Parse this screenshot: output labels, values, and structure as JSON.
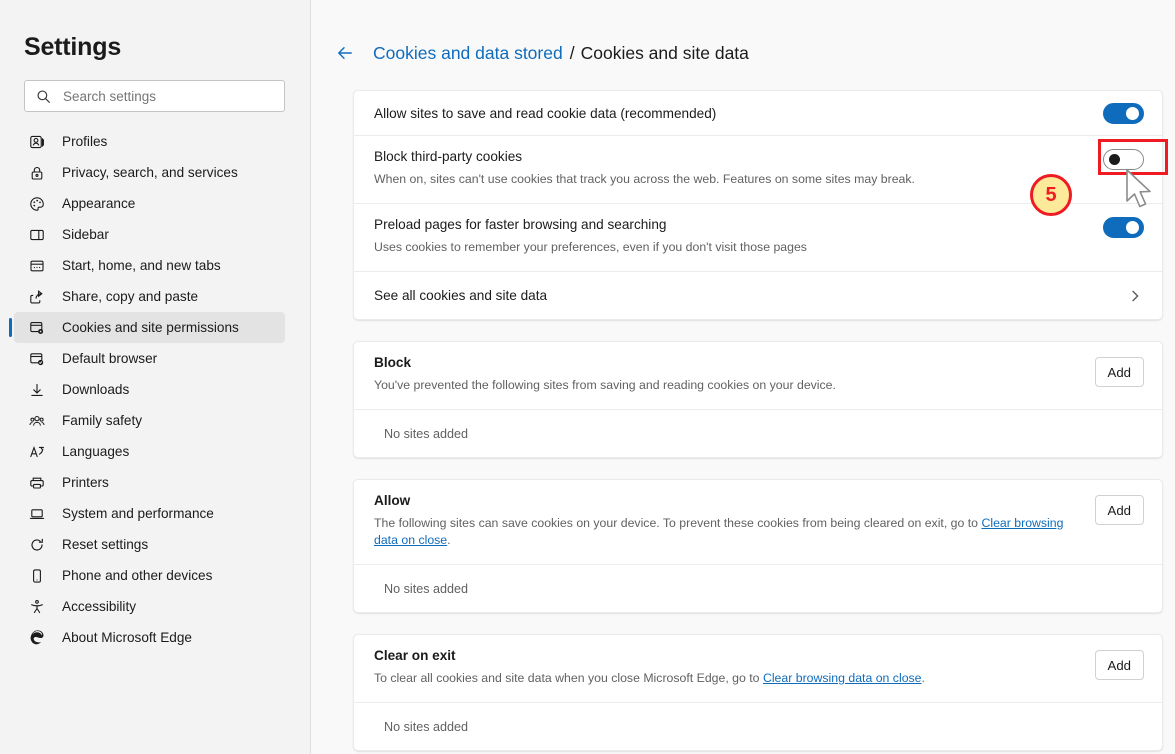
{
  "sidebar": {
    "title": "Settings",
    "search": {
      "placeholder": "Search settings",
      "value": "",
      "icon": "search-icon"
    },
    "items": [
      {
        "label": "Profiles",
        "icon": "profiles-icon",
        "selected": false
      },
      {
        "label": "Privacy, search, and services",
        "icon": "lock-icon",
        "selected": false
      },
      {
        "label": "Appearance",
        "icon": "palette-icon",
        "selected": false
      },
      {
        "label": "Sidebar",
        "icon": "sidebar-icon",
        "selected": false
      },
      {
        "label": "Start, home, and new tabs",
        "icon": "browser-window-icon",
        "selected": false
      },
      {
        "label": "Share, copy and paste",
        "icon": "share-icon",
        "selected": false
      },
      {
        "label": "Cookies and site permissions",
        "icon": "cookie-permissions-icon",
        "selected": true
      },
      {
        "label": "Default browser",
        "icon": "default-browser-icon",
        "selected": false
      },
      {
        "label": "Downloads",
        "icon": "download-icon",
        "selected": false
      },
      {
        "label": "Family safety",
        "icon": "family-icon",
        "selected": false
      },
      {
        "label": "Languages",
        "icon": "languages-icon",
        "selected": false
      },
      {
        "label": "Printers",
        "icon": "printer-icon",
        "selected": false
      },
      {
        "label": "System and performance",
        "icon": "laptop-icon",
        "selected": false
      },
      {
        "label": "Reset settings",
        "icon": "reset-icon",
        "selected": false
      },
      {
        "label": "Phone and other devices",
        "icon": "phone-icon",
        "selected": false
      },
      {
        "label": "Accessibility",
        "icon": "accessibility-icon",
        "selected": false
      },
      {
        "label": "About Microsoft Edge",
        "icon": "edge-logo-icon",
        "selected": false
      }
    ]
  },
  "breadcrumb": {
    "back_icon": "back-arrow-icon",
    "parent": "Cookies and data stored",
    "separator": "/",
    "current": "Cookies and site data"
  },
  "main": {
    "settings_card": {
      "rows": [
        {
          "title": "Allow sites to save and read cookie data (recommended)",
          "desc": "",
          "control": "toggle",
          "state": "on"
        },
        {
          "title": "Block third-party cookies",
          "desc": "When on, sites can't use cookies that track you across the web. Features on some sites may break.",
          "control": "toggle",
          "state": "off"
        },
        {
          "title": "Preload pages for faster browsing and searching",
          "desc": "Uses cookies to remember your preferences, even if you don't visit those pages",
          "control": "toggle",
          "state": "on"
        },
        {
          "title": "See all cookies and site data",
          "desc": "",
          "control": "chevron",
          "state": ""
        }
      ]
    },
    "site_cards": [
      {
        "title": "Block",
        "desc_prefix": "You've prevented the following sites from saving and reading cookies on your device.",
        "link_text": "",
        "desc_suffix": "",
        "add_label": "Add",
        "empty_text": "No sites added"
      },
      {
        "title": "Allow",
        "desc_prefix": "The following sites can save cookies on your device. To prevent these cookies from being cleared on exit, go to ",
        "link_text": "Clear browsing data on close",
        "desc_suffix": ".",
        "add_label": "Add",
        "empty_text": "No sites added"
      },
      {
        "title": "Clear on exit",
        "desc_prefix": "To clear all cookies and site data when you close Microsoft Edge, go to ",
        "link_text": "Clear browsing data on close",
        "desc_suffix": ".",
        "add_label": "Add",
        "empty_text": "No sites added"
      }
    ]
  },
  "annotation": {
    "step_number": "5",
    "highlight_color": "#ee1c22",
    "badge_fill": "#fde99a",
    "cursor_icon": "mouse-pointer-icon"
  },
  "colors": {
    "accent": "#0f6cbd",
    "sidebar_bg": "#f3f3f3",
    "content_bg": "#f9f9f9",
    "card_bg": "#ffffff"
  }
}
